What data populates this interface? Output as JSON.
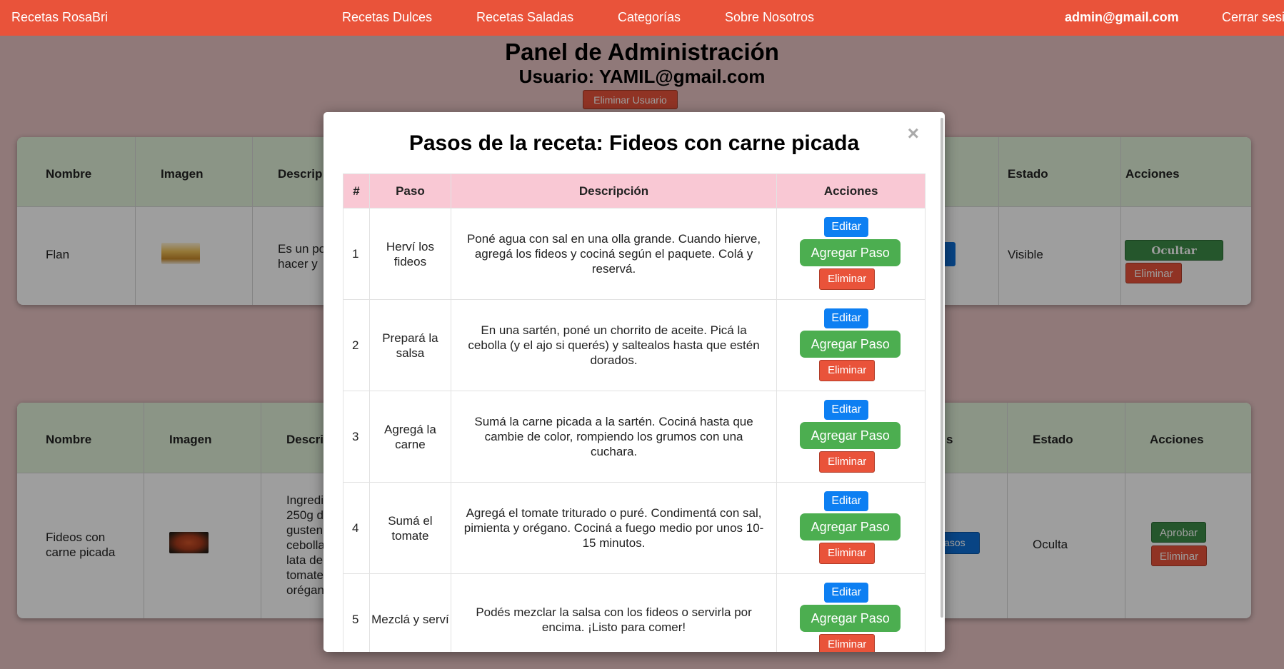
{
  "nav": {
    "brand": "Recetas RosaBri",
    "links": [
      "Recetas Dulces",
      "Recetas Saladas",
      "Categorías",
      "Sobre Nosotros"
    ],
    "user_email": "admin@gmail.com",
    "logout": "Cerrar sesi"
  },
  "page": {
    "title": "Panel de Administración",
    "user_line": "Usuario: YAMIL@gmail.com",
    "delete_user": "Eliminar Usuario"
  },
  "table1": {
    "headers": [
      "Nombre",
      "Imagen",
      "Descrip",
      "Estado",
      "Acciones"
    ],
    "row": {
      "name": "Flan",
      "desc_line1": "Es un po",
      "desc_line2": "hacer y",
      "status": "Visible",
      "btn_toggle": "Ocultar",
      "btn_delete": "Eliminar"
    }
  },
  "table2": {
    "headers": [
      "Nombre",
      "Imagen",
      "Descri",
      "s",
      "Estado",
      "Acciones"
    ],
    "row": {
      "name_line1": "Fideos con",
      "name_line2": "carne picada",
      "desc_lines": [
        "Ingredi",
        "250g d",
        "gusten",
        "cebolla",
        "lata de",
        "tomate",
        "orégan"
      ],
      "steps_btn_partial": "pasos",
      "status": "Oculta",
      "btn_toggle": "Aprobar",
      "btn_delete": "Eliminar"
    }
  },
  "modal": {
    "title": "Pasos de la receta: Fideos con carne picada",
    "close": "×",
    "headers": [
      "#",
      "Paso",
      "Descripción",
      "Acciones"
    ],
    "btn_edit": "Editar",
    "btn_add": "Agregar Paso",
    "btn_delete": "Eliminar",
    "steps": [
      {
        "num": "1",
        "name": "Herví los fideos",
        "desc": "Poné agua con sal en una olla grande. Cuando hierve, agregá los fideos y cociná según el paquete. Colá y reservá."
      },
      {
        "num": "2",
        "name": "Prepará la salsa",
        "desc": "En una sartén, poné un chorrito de aceite. Picá la cebolla (y el ajo si querés) y saltealos hasta que estén dorados."
      },
      {
        "num": "3",
        "name": "Agregá la carne",
        "desc": "Sumá la carne picada a la sartén. Cociná hasta que cambie de color, rompiendo los grumos con una cuchara."
      },
      {
        "num": "4",
        "name": "Sumá el tomate",
        "desc": "Agregá el tomate triturado o puré. Condimentá con sal, pimienta y orégano. Cociná a fuego medio por unos 10-15 minutos."
      },
      {
        "num": "5",
        "name": "Mezclá y serví",
        "desc": "Podés mezclar la salsa con los fideos o servirla por encima. ¡Listo para comer!"
      }
    ]
  }
}
